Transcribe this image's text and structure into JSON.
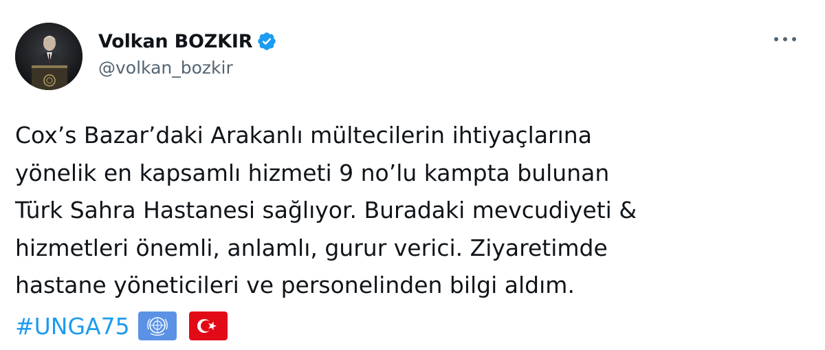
{
  "author": {
    "display_name": "Volkan BOZKIR",
    "handle": "@volkan_bozkir",
    "verified": true,
    "avatar_icon": "profile-photo-speaker-at-podium"
  },
  "menu": {
    "icon": "more-horizontal-icon"
  },
  "tweet": {
    "lines": [
      "Cox’s Bazar’daki Arakanlı mültecilerin ihtiyaçlarına",
      "yönelik en kapsamlı hizmeti 9 no’lu kampta bulunan",
      "Türk Sahra Hastanesi sağlıyor. Buradaki mevcudiyeti &",
      "hizmetleri önemli, anlamlı, gurur verici. Ziyaretimde",
      "hastane yöneticileri ve personelinden bilgi aldım."
    ],
    "hashtag": "#UNGA75",
    "emojis": [
      "united-nations-flag",
      "turkey-flag"
    ]
  },
  "colors": {
    "text": "#0f1419",
    "secondary": "#536471",
    "link": "#1d9bf0",
    "verified": "#1d9bf0",
    "un_blue": "#5b92e5",
    "turkey_red": "#e30a17"
  }
}
